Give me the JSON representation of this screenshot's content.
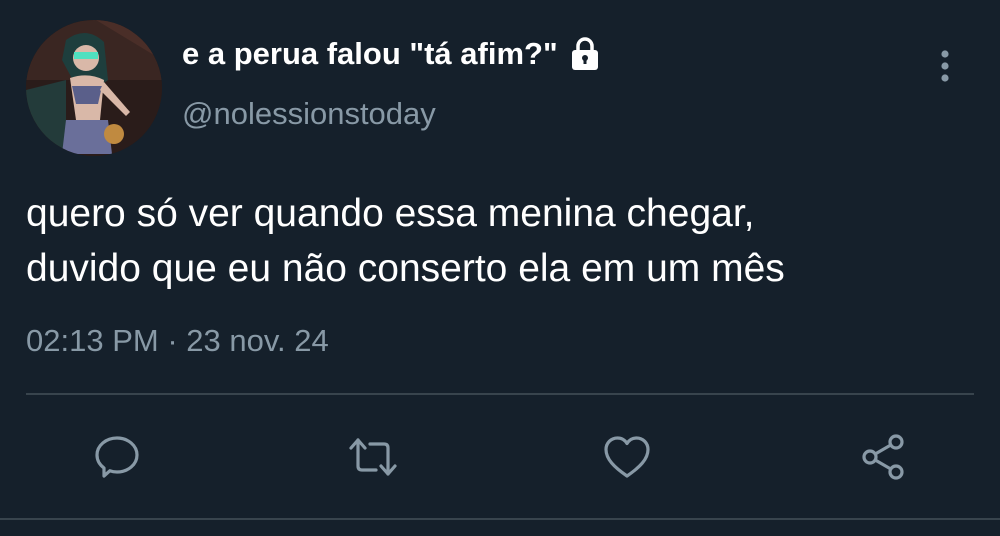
{
  "tweet": {
    "display_name": "e a perua falou \"tá afim?\"",
    "handle": "@nolessionstoday",
    "protected": true,
    "text_lines": [
      "quero só ver quando essa menina chegar,",
      "duvido que eu não conserto ela em um mês"
    ],
    "time": "02:13 PM",
    "separator": "·",
    "date": "23 nov. 24"
  },
  "icons": {
    "lock": "lock-icon",
    "more": "more-vertical-icon",
    "reply": "reply-icon",
    "retweet": "retweet-icon",
    "like": "heart-icon",
    "share": "share-icon"
  },
  "colors": {
    "background": "#15202b",
    "text": "#ffffff",
    "secondary_text": "#8899a6",
    "divider": "#38444d",
    "icon": "#8899a6"
  }
}
